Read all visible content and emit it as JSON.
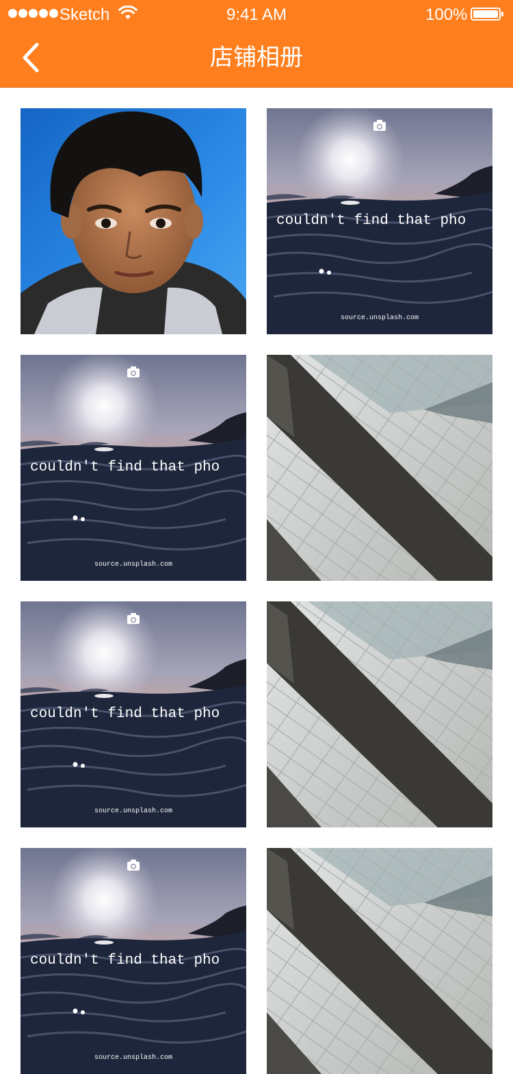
{
  "status_bar": {
    "carrier": "Sketch",
    "time": "9:41 AM",
    "battery": "100%",
    "battery_level": 1.0
  },
  "nav": {
    "title": "店铺相册",
    "back_icon": "chevron-left-icon"
  },
  "colors": {
    "brand": "#FF7F1E",
    "background": "#FFFFFF"
  },
  "placeholder": {
    "message": "couldn't find that pho",
    "source": "source.unsplash.com",
    "icon": "camera-icon"
  },
  "photos": [
    {
      "kind": "portrait"
    },
    {
      "kind": "placeholder"
    },
    {
      "kind": "placeholder"
    },
    {
      "kind": "architecture"
    },
    {
      "kind": "placeholder"
    },
    {
      "kind": "architecture"
    },
    {
      "kind": "placeholder"
    },
    {
      "kind": "architecture"
    }
  ]
}
